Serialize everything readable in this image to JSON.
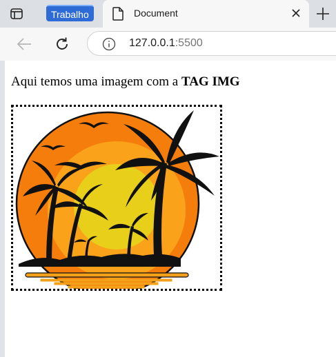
{
  "browser": {
    "workspace_label": "Trabalho",
    "tab": {
      "title": "Document"
    },
    "address": {
      "host": "127.0.0.1",
      "port": ":5500"
    },
    "icons": {
      "tab_actions": "tab-actions-icon",
      "document": "document-icon",
      "close": "close-icon",
      "new_tab": "plus-icon",
      "back": "back-arrow-icon",
      "reload": "reload-icon",
      "site_info": "info-icon"
    },
    "colors": {
      "workspace": "#2e6bd6",
      "tab_strip": "#dcdfe4"
    }
  },
  "page": {
    "text_prefix": "Aqui temos uma imagem com a ",
    "text_bold": "TAG IMG",
    "image": {
      "subject": "sunset-palm-trees-illustration",
      "border": "dotted"
    }
  }
}
